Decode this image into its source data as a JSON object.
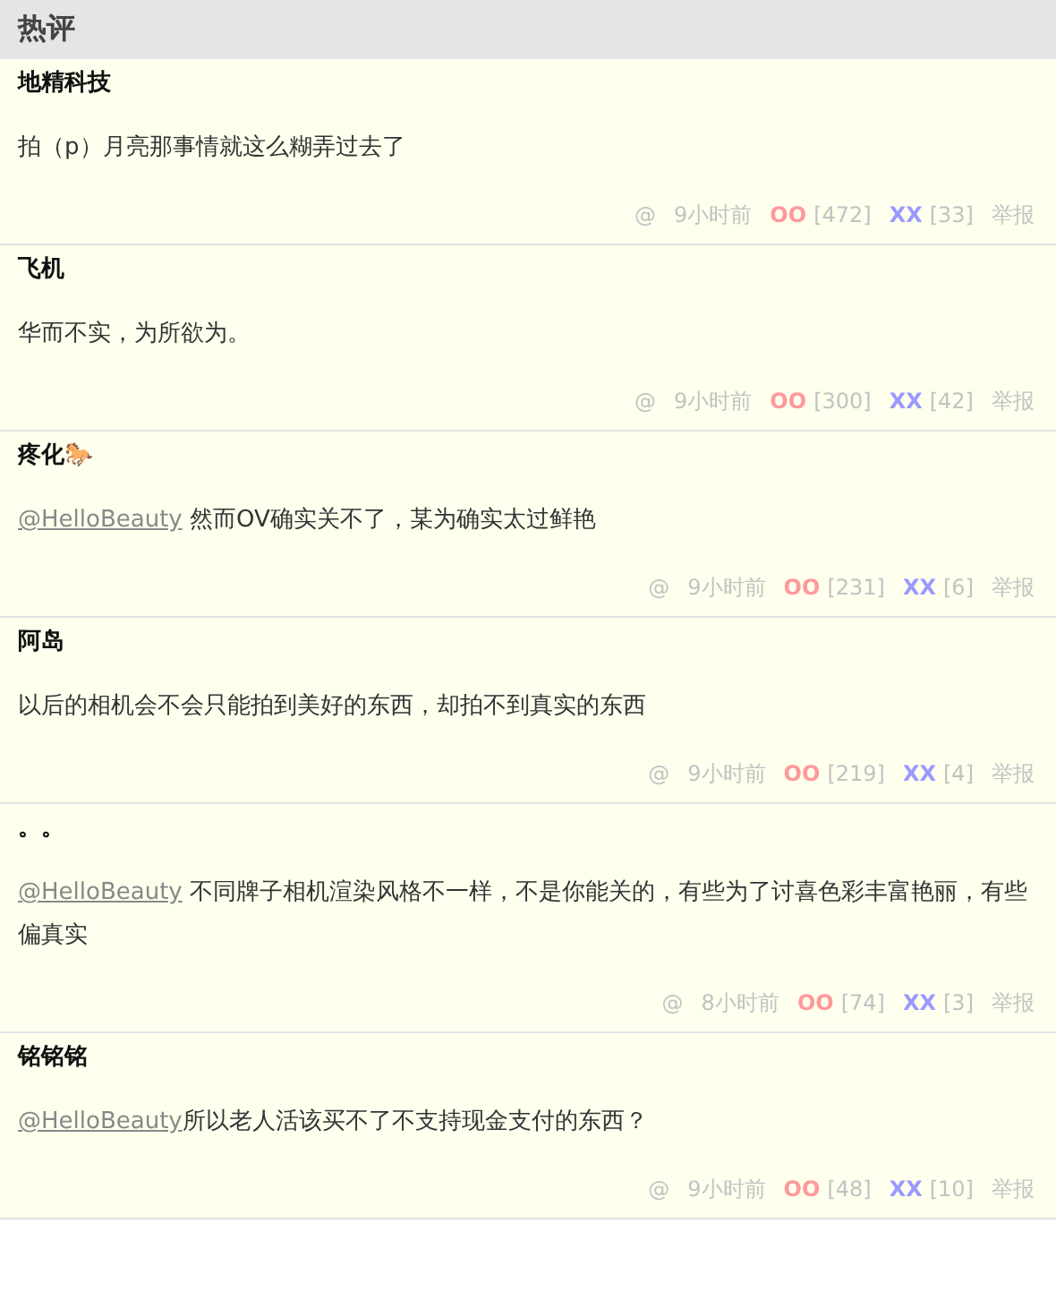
{
  "header": {
    "title": "热评"
  },
  "comments": [
    {
      "author": "地精科技",
      "text": "拍（p）月亮那事情就这么糊弄过去了",
      "time": "9小时前",
      "oo": "OO",
      "oo_count": "[472]",
      "xx": "XX",
      "xx_count": "[33]",
      "reply": "@",
      "report": "举报"
    },
    {
      "author": "飞机",
      "text": "华而不实，为所欲为。",
      "time": "9小时前",
      "oo": "OO",
      "oo_count": "[300]",
      "xx": "XX",
      "xx_count": "[42]",
      "reply": "@",
      "report": "举报"
    },
    {
      "author": "疼化🐎",
      "mention": "@HelloBeauty",
      "text": " 然而OV确实关不了，某为确实太过鲜艳",
      "time": "9小时前",
      "oo": "OO",
      "oo_count": "[231]",
      "xx": "XX",
      "xx_count": "[6]",
      "reply": "@",
      "report": "举报"
    },
    {
      "author": "阿岛",
      "text": "以后的相机会不会只能拍到美好的东西，却拍不到真实的东西",
      "time": "9小时前",
      "oo": "OO",
      "oo_count": "[219]",
      "xx": "XX",
      "xx_count": "[4]",
      "reply": "@",
      "report": "举报"
    },
    {
      "author": "。。",
      "mention": "@HelloBeauty",
      "text": " 不同牌子相机渲染风格不一样，不是你能关的，有些为了讨喜色彩丰富艳丽，有些偏真实",
      "time": "8小时前",
      "oo": "OO",
      "oo_count": "[74]",
      "xx": "XX",
      "xx_count": "[3]",
      "reply": "@",
      "report": "举报"
    },
    {
      "author": "铭铭铭",
      "mention": "@HelloBeauty",
      "text": "所以老人活该买不了不支持现金支付的东西？",
      "time": "9小时前",
      "oo": "OO",
      "oo_count": "[48]",
      "xx": "XX",
      "xx_count": "[10]",
      "reply": "@",
      "report": "举报"
    }
  ]
}
